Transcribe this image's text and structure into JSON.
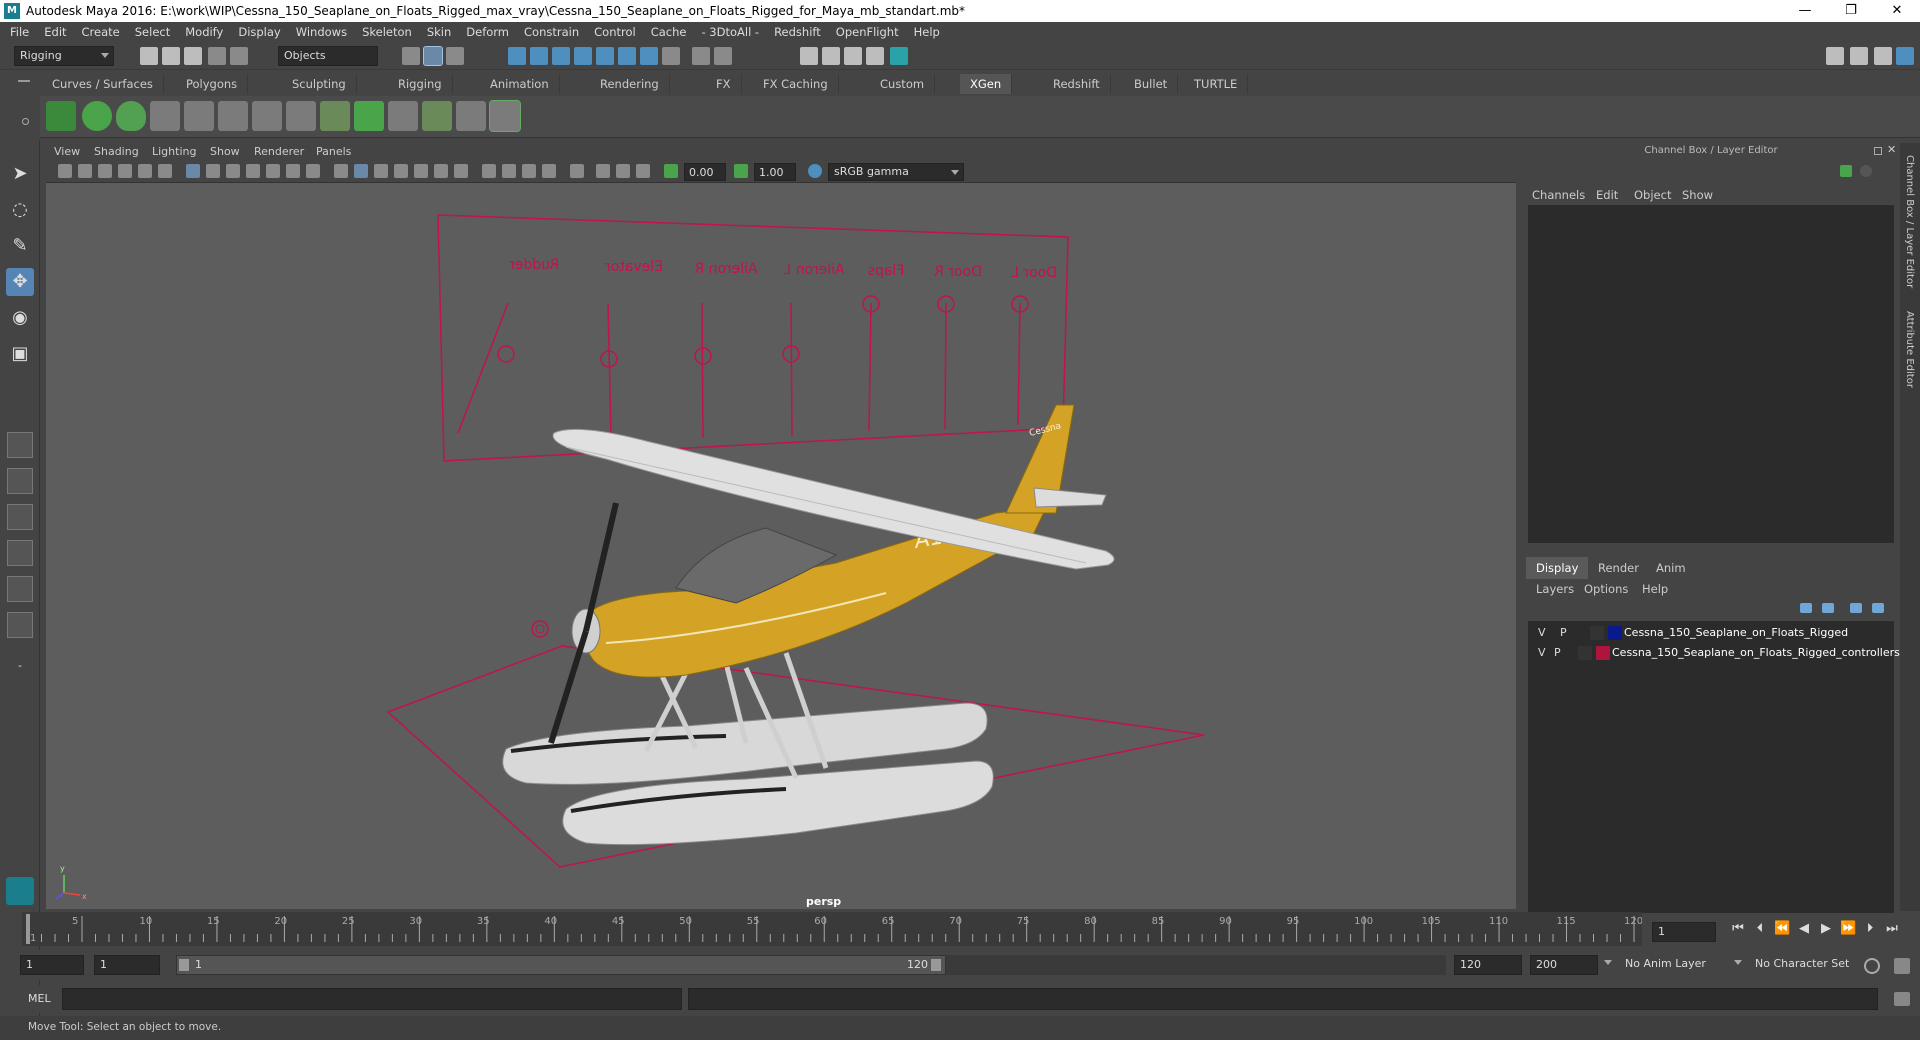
{
  "window": {
    "title": "Autodesk Maya 2016: E:\\work\\WIP\\Cessna_150_Seaplane_on_Floats_Rigged_max_vray\\Cessna_150_Seaplane_on_Floats_Rigged_for_Maya_mb_standart.mb*",
    "app_icon": "M",
    "minimize": "—",
    "maximize": "❐",
    "close": "✕"
  },
  "menubar": [
    "File",
    "Edit",
    "Create",
    "Select",
    "Modify",
    "Display",
    "Windows",
    "Skeleton",
    "Skin",
    "Deform",
    "Constrain",
    "Control",
    "Cache",
    "- 3DtoAll -",
    "Redshift",
    "OpenFlight",
    "Help"
  ],
  "statusline": {
    "menuset": "Rigging",
    "selection_mode": "Objects"
  },
  "shelf_tabs": [
    "Curves / Surfaces",
    "Polygons",
    "Sculpting",
    "Rigging",
    "Animation",
    "Rendering",
    "FX",
    "FX Caching",
    "Custom",
    "XGen",
    "Redshift",
    "Bullet",
    "TURTLE"
  ],
  "active_shelf_tab": "XGen",
  "viewport": {
    "menu": [
      "View",
      "Shading",
      "Lighting",
      "Show",
      "Renderer",
      "Panels"
    ],
    "exposure": "0.00",
    "gamma": "1.00",
    "color_space": "sRGB gamma",
    "camera_label": "persp",
    "controller_labels": [
      "Rudder",
      "Elevator",
      "Aileron R",
      "Aileron L",
      "Flaps",
      "Door R",
      "Door L"
    ],
    "plane_registration": "A10A",
    "plane_brand": "Cessna",
    "axis_y": "y",
    "axis_x": "x"
  },
  "channel_box": {
    "title": "Channel Box / Layer Editor",
    "menu": [
      "Channels",
      "Edit",
      "Object",
      "Show"
    ]
  },
  "layer_editor": {
    "tabs": [
      "Display",
      "Render",
      "Anim"
    ],
    "active_tab": "Display",
    "menu": [
      "Layers",
      "Options",
      "Help"
    ],
    "layers": [
      {
        "v": "V",
        "p": "P",
        "name": "Cessna_150_Seaplane_on_Floats_Rigged",
        "color": "#0a1a8c"
      },
      {
        "v": "V",
        "p": "P",
        "name": "Cessna_150_Seaplane_on_Floats_Rigged_controllers",
        "color": "#b0143c"
      }
    ]
  },
  "side_tabs": [
    "Channel Box / Layer Editor",
    "Attribute Editor"
  ],
  "timeline": {
    "ticks": [
      "1",
      "5",
      "10",
      "15",
      "20",
      "25",
      "30",
      "35",
      "40",
      "45",
      "50",
      "55",
      "60",
      "65",
      "70",
      "75",
      "80",
      "85",
      "90",
      "95",
      "100",
      "105",
      "110",
      "115",
      "120"
    ],
    "current_frame": "1"
  },
  "range": {
    "start": "1",
    "playback_start": "1",
    "slider_start": "1",
    "slider_end": "120",
    "playback_end": "120",
    "end": "200",
    "anim_layer": "No Anim Layer",
    "character_set": "No Character Set"
  },
  "command_line": {
    "label": "MEL"
  },
  "help_line": "Move Tool: Select an object to move.",
  "colors": {
    "accent": "#5485b4",
    "controller": "#c0144a",
    "plane_yellow": "#d4a326"
  }
}
